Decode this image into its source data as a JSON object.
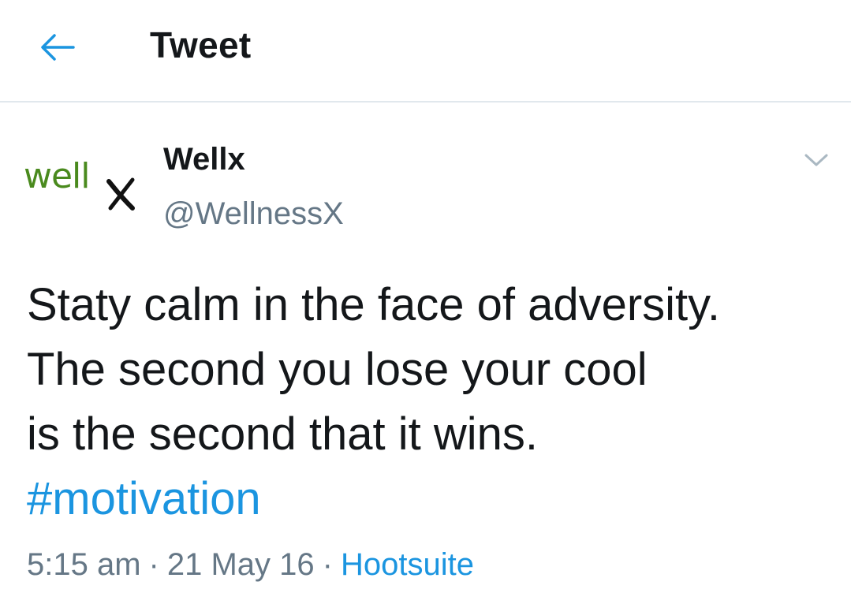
{
  "header": {
    "title": "Tweet",
    "back_icon": "arrow-left-icon"
  },
  "author": {
    "avatar_text": "well",
    "avatar_mark": "x-mark-icon",
    "name": "Wellx",
    "handle": "@WellnessX"
  },
  "tweet": {
    "lines": [
      "Staty calm in the face of adversity.",
      "The second you lose your cool",
      "is the second that it wins."
    ],
    "hashtag": "#motivation"
  },
  "meta": {
    "time": "5:15 am",
    "separator": "·",
    "date": "21 May 16",
    "source": "Hootsuite"
  },
  "colors": {
    "accent": "#1b95e0",
    "text": "#14171a",
    "muted": "#657786",
    "avatar_green": "#4a8a1e"
  }
}
